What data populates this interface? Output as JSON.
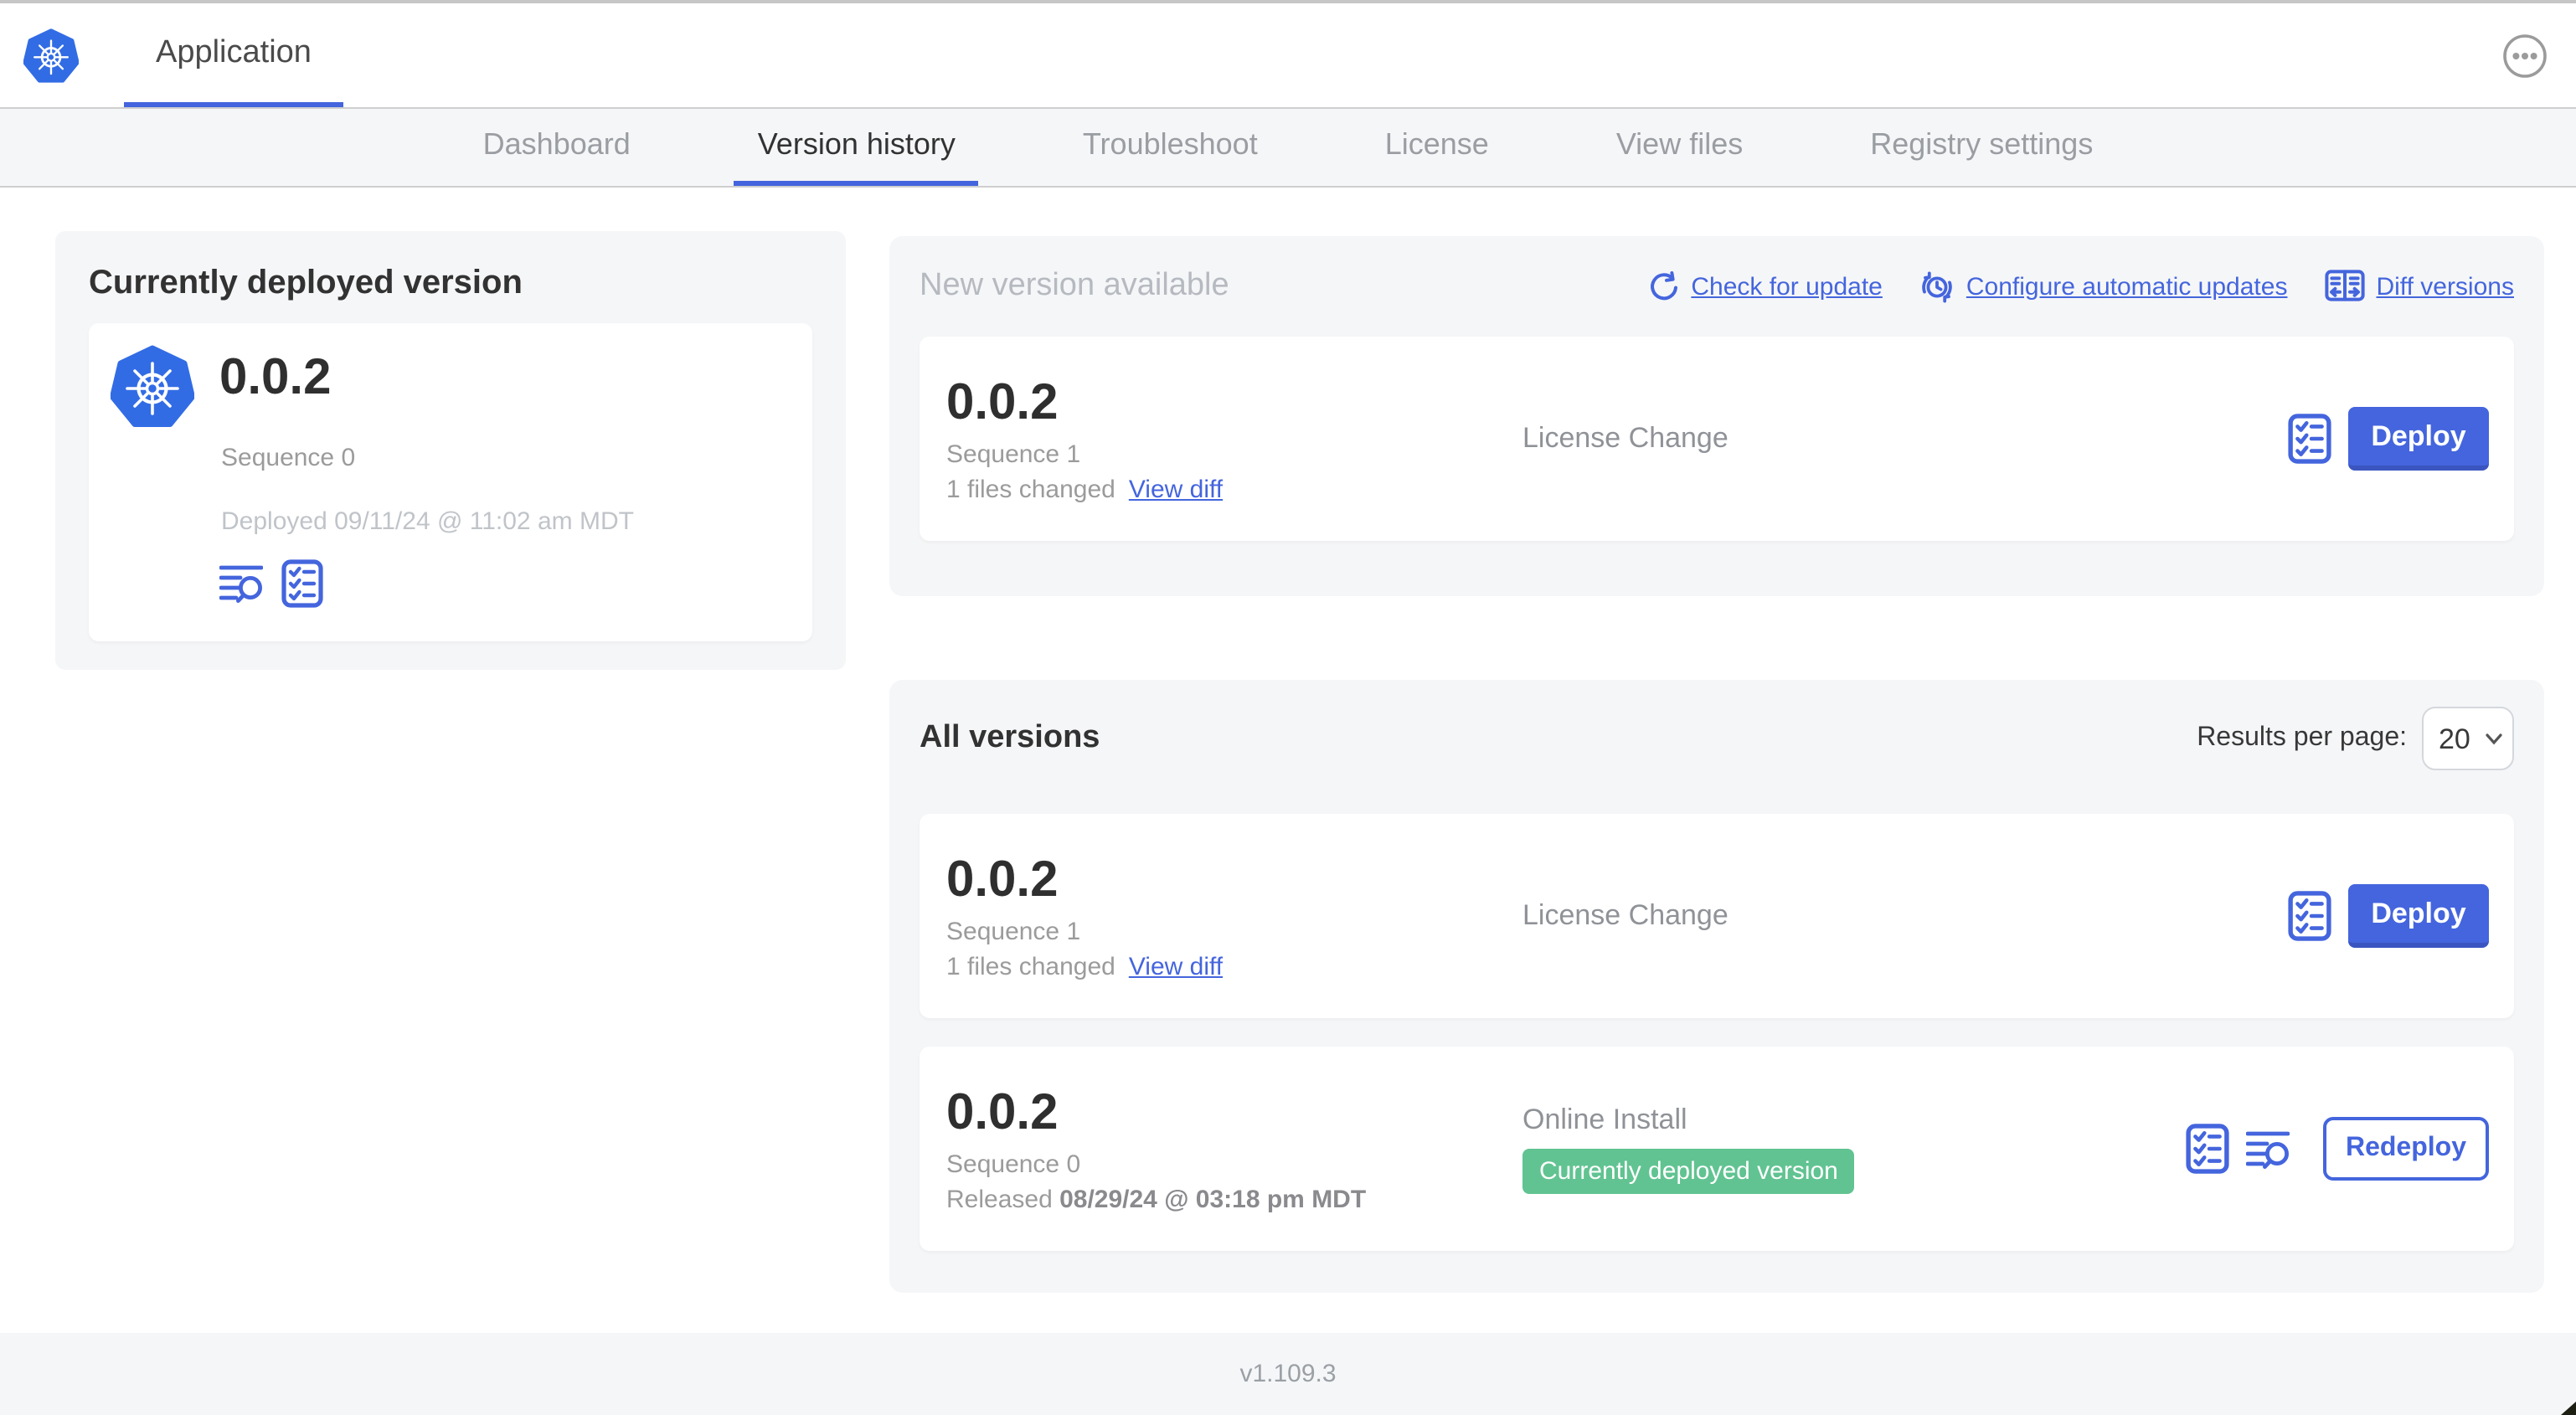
{
  "colors": {
    "accent": "#4465dd",
    "logo_blue": "#326ce5",
    "badge_green": "#61c391"
  },
  "header": {
    "app_title": "Application"
  },
  "nav": {
    "tabs": [
      {
        "label": "Dashboard",
        "active": false
      },
      {
        "label": "Version history",
        "active": true
      },
      {
        "label": "Troubleshoot",
        "active": false
      },
      {
        "label": "License",
        "active": false
      },
      {
        "label": "View files",
        "active": false
      },
      {
        "label": "Registry settings",
        "active": false
      }
    ]
  },
  "left_panel": {
    "title": "Currently deployed version",
    "version": "0.0.2",
    "sequence": "Sequence 0",
    "deployed": "Deployed 09/11/24 @ 11:02 am MDT"
  },
  "new_version": {
    "title": "New version available",
    "links": {
      "check": "Check for update",
      "configure": "Configure automatic updates",
      "diff": "Diff versions"
    },
    "row": {
      "version": "0.0.2",
      "sequence": "Sequence 1",
      "files_changed": "1 files changed",
      "view_diff": "View diff",
      "source": "License Change",
      "deploy_label": "Deploy"
    }
  },
  "all_versions": {
    "title": "All versions",
    "results_per_page_label": "Results per page:",
    "results_per_page_value": "20",
    "rows": [
      {
        "version": "0.0.2",
        "sequence": "Sequence 1",
        "files_changed": "1 files changed",
        "view_diff": "View diff",
        "source": "License Change",
        "deploy_label": "Deploy"
      },
      {
        "version": "0.0.2",
        "sequence": "Sequence 0",
        "released_prefix": "Released ",
        "released_date": "08/29/24 @ 03:18 pm MDT",
        "source": "Online Install",
        "badge": "Currently deployed version",
        "redeploy_label": "Redeploy"
      }
    ]
  },
  "footer": {
    "version": "v1.109.3"
  }
}
